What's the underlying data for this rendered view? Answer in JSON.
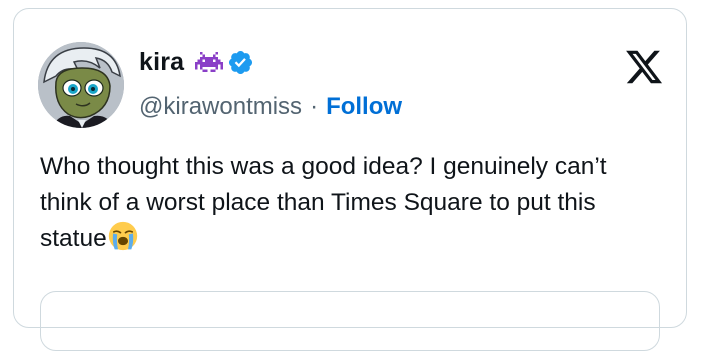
{
  "tweet": {
    "author": {
      "display_name": "kira",
      "handle": "@kirawontmiss",
      "badge_icons": [
        "space-invader-icon",
        "verified-check-icon"
      ],
      "verified_color": "#1d9bf0"
    },
    "separator": "·",
    "follow_label": "Follow",
    "text": "Who thought this was a good idea? I genuinely can’t think of a worst place than Times Square to put this statue",
    "trailing_emoji": "loudly-crying-face-emoji",
    "platform_logo": "x-logo-icon",
    "colors": {
      "link": "#006fd6",
      "text": "#0f1419",
      "secondary": "#536471",
      "border": "#cfd9de",
      "invader": "#8a3fc7"
    }
  }
}
